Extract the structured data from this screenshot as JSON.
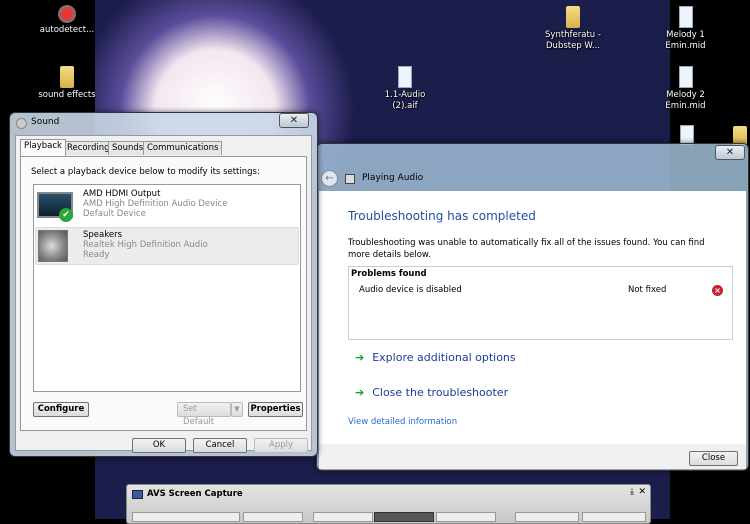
{
  "desktop": {
    "icons": [
      {
        "label": "autodetect...",
        "type": "app"
      },
      {
        "label": "sound effects",
        "type": "folder"
      },
      {
        "label": "1.1-Audio (2).aif",
        "type": "file"
      },
      {
        "label": "Synthferatu - Dubstep W...",
        "type": "folder"
      },
      {
        "label": "Melody 1 Emin.mid",
        "type": "file"
      },
      {
        "label": "Melody 2 Emin.mid",
        "type": "file"
      }
    ]
  },
  "sound": {
    "title": "Sound",
    "close": "✕",
    "tabs": [
      "Playback",
      "Recording",
      "Sounds",
      "Communications"
    ],
    "instruction": "Select a playback device below to modify its settings:",
    "devices": [
      {
        "name": "AMD HDMI Output",
        "driver": "AMD High Definition Audio Device",
        "status": "Default Device",
        "icon": "monitor-icon"
      },
      {
        "name": "Speakers",
        "driver": "Realtek High Definition Audio",
        "status": "Ready",
        "icon": "speaker-icon"
      }
    ],
    "configure": "Configure",
    "set_default": "Set Default",
    "properties": "Properties",
    "ok": "OK",
    "cancel": "Cancel",
    "apply": "Apply"
  },
  "troubleshooter": {
    "title": "Playing Audio",
    "close": "✕",
    "heading": "Troubleshooting has completed",
    "description": "Troubleshooting was unable to automatically fix all of the issues found. You can find more details below.",
    "problems_header": "Problems found",
    "problems": [
      {
        "issue": "Audio device is disabled",
        "status": "Not fixed"
      }
    ],
    "options": [
      "Explore additional options",
      "Close the troubleshooter"
    ],
    "details_link": "View detailed information",
    "close_button": "Close",
    "heading_color": "#1e50a2"
  },
  "avs": {
    "title": "AVS Screen Capture"
  }
}
